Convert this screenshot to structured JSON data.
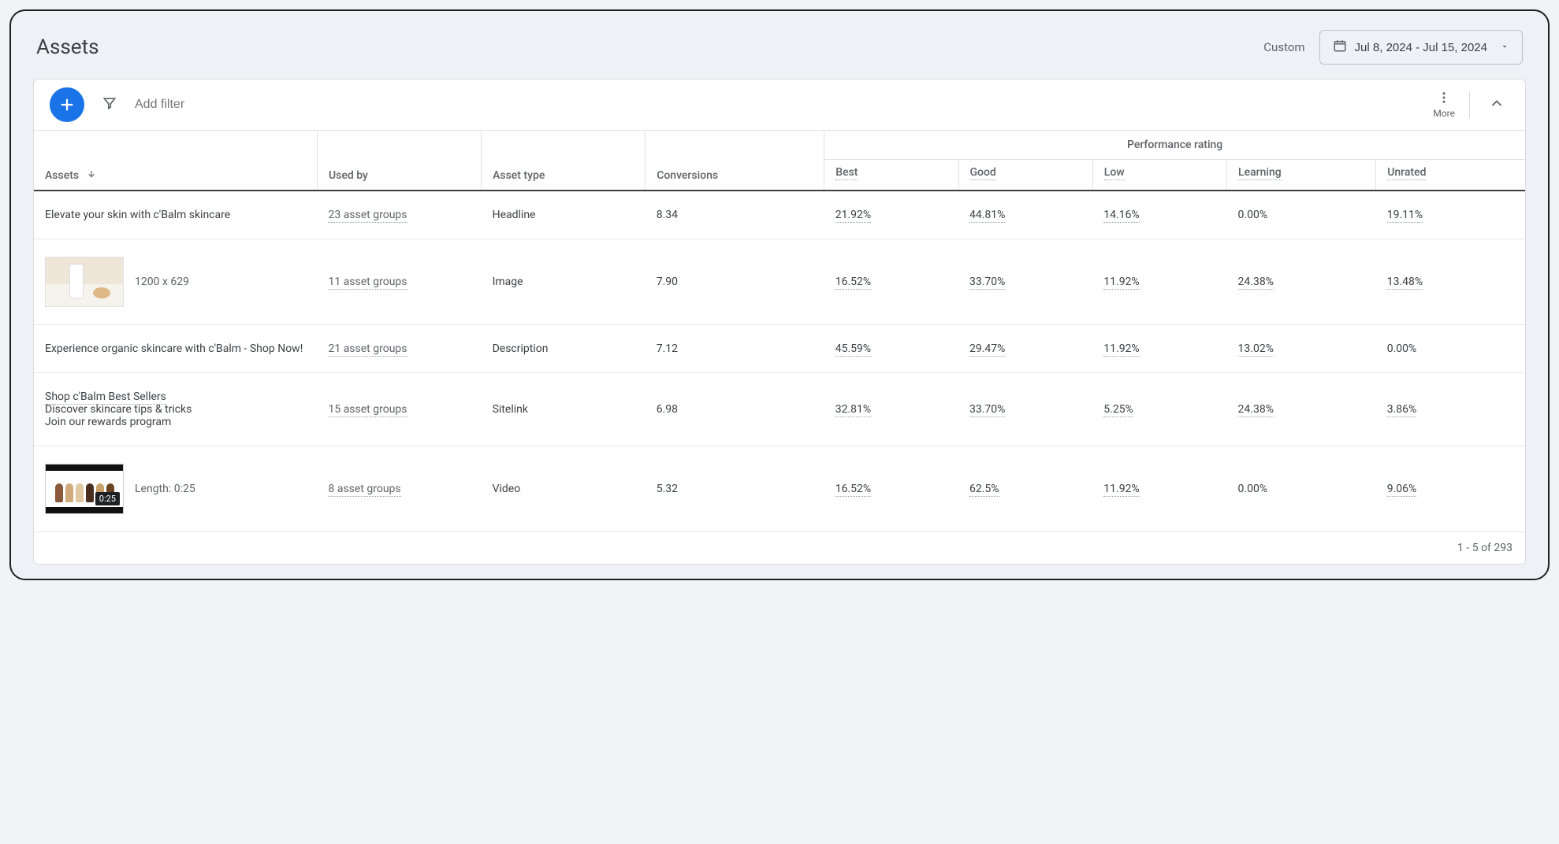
{
  "page_title": "Assets",
  "date_label": "Custom",
  "date_range": "Jul 8, 2024 - Jul 15, 2024",
  "toolbar": {
    "add_filter_placeholder": "Add filter",
    "more_label": "More"
  },
  "table": {
    "headers": {
      "assets": "Assets",
      "used_by": "Used by",
      "asset_type": "Asset type",
      "conversions": "Conversions",
      "performance_group": "Performance rating",
      "best": "Best",
      "good": "Good",
      "low": "Low",
      "learning": "Learning",
      "unrated": "Unrated"
    },
    "rows": [
      {
        "asset_text": "Elevate your skin with c'Balm skincare",
        "thumb": null,
        "meta": null,
        "used_by": "23 asset groups",
        "asset_type": "Headline",
        "conversions": "8.34",
        "best": "21.92%",
        "good": "44.81%",
        "low": "14.16%",
        "learning": "0.00%",
        "unrated": "19.11%"
      },
      {
        "asset_text": null,
        "thumb": "product",
        "meta": "1200 x 629",
        "used_by": "11 asset groups",
        "asset_type": "Image",
        "conversions": "7.90",
        "best": "16.52%",
        "good": "33.70%",
        "low": "11.92%",
        "learning": "24.38%",
        "unrated": "13.48%"
      },
      {
        "asset_text": "Experience organic skincare with c'Balm - Shop Now!",
        "thumb": null,
        "meta": null,
        "used_by": "21 asset groups",
        "asset_type": "Description",
        "conversions": "7.12",
        "best": "45.59%",
        "good": "29.47%",
        "low": "11.92%",
        "learning": "13.02%",
        "unrated": "0.00%"
      },
      {
        "sitelink_title": "Shop c'Balm Best Sellers",
        "sitelink_line2": "Discover skincare tips & tricks",
        "sitelink_line3": "Join our rewards program",
        "thumb": null,
        "meta": null,
        "used_by": "15 asset groups",
        "asset_type": "Sitelink",
        "conversions": "6.98",
        "best": "32.81%",
        "good": "33.70%",
        "low": "5.25%",
        "learning": "24.38%",
        "unrated": "3.86%"
      },
      {
        "asset_text": null,
        "thumb": "video",
        "video_badge": "0:25",
        "meta": "Length: 0:25",
        "used_by": "8 asset groups",
        "asset_type": "Video",
        "conversions": "5.32",
        "best": "16.52%",
        "good": "62.5%",
        "low": "11.92%",
        "learning": "0.00%",
        "unrated": "9.06%"
      }
    ]
  },
  "pager": "1 - 5 of 293"
}
